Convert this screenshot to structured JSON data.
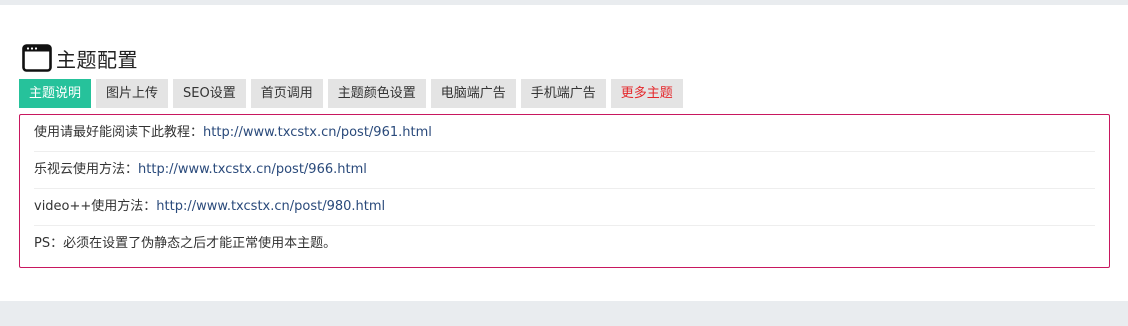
{
  "header": {
    "title": "主题配置",
    "icon": "browser-window-icon"
  },
  "tabs": [
    {
      "label": "主题说明",
      "active": true
    },
    {
      "label": "图片上传"
    },
    {
      "label": "SEO设置"
    },
    {
      "label": "首页调用"
    },
    {
      "label": "主题颜色设置"
    },
    {
      "label": "电脑端广告"
    },
    {
      "label": "手机端广告"
    },
    {
      "label": "更多主题",
      "highlight_color": "#e4272b"
    }
  ],
  "content": {
    "lines": [
      {
        "text": "使用请最好能阅读下此教程：",
        "link": "http://www.txcstx.cn/post/961.html"
      },
      {
        "text": "乐视云使用方法：",
        "link": "http://www.txcstx.cn/post/966.html"
      },
      {
        "text": "video++使用方法：",
        "link": "http://www.txcstx.cn/post/980.html"
      },
      {
        "text": "PS：必须在设置了伪静态之后才能正常使用本主题。"
      }
    ]
  },
  "colors": {
    "active_tab": "#26c29b",
    "border_accent": "#c8175f",
    "link": "#2a4a7b"
  }
}
